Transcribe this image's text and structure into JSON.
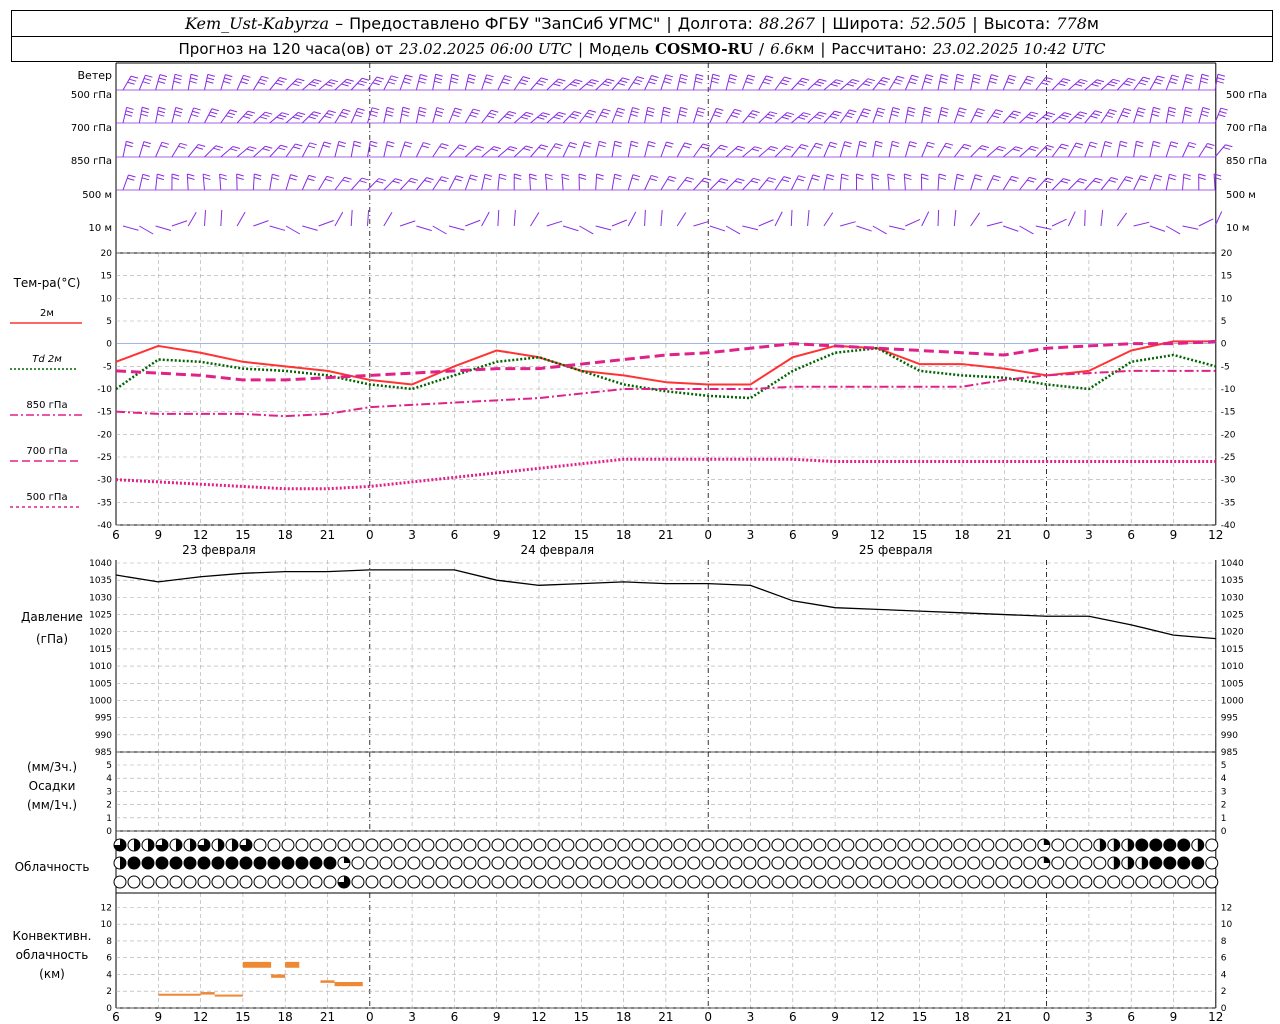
{
  "header": {
    "station": "Kem_Ust-Kabyrza",
    "dash": "–",
    "provider": "Предоставлено ФГБУ \"ЗапСиб УГМС\"",
    "sep": "|",
    "lon_label": "Долгота:",
    "lon": "88.267",
    "lat_label": "Широта:",
    "lat": "52.505",
    "alt_label": "Высота:",
    "alt": "778",
    "alt_unit": "м",
    "forecast": "Прогноз на 120 часа(ов) от",
    "start": "23.02.2025 06:00 UTC",
    "model_label": "Модель",
    "model": "COSMO-RU",
    "slash": "/",
    "res": "6.6",
    "res_unit": "км",
    "calc_label": "Рассчитано:",
    "calc": "23.02.2025 10:42 UTC"
  },
  "wind": {
    "title": "Ветер",
    "levels": [
      "500 гПа",
      "700 гПа",
      "850 гПа",
      "500 м",
      "10  м"
    ],
    "levels_right": [
      "500 гПа",
      "700 гПа",
      "850 гПа",
      "500 м",
      "10  м"
    ],
    "color": "#8a2be2"
  },
  "axis": {
    "hours": [
      "6",
      "9",
      "12",
      "15",
      "18",
      "21",
      "0",
      "3",
      "6",
      "9",
      "12",
      "15",
      "18",
      "21",
      "0",
      "3",
      "6",
      "9",
      "12",
      "15",
      "18",
      "21",
      "0",
      "3",
      "6",
      "9",
      "12"
    ],
    "dates": [
      "23 февраля",
      "24 февраля",
      "25 февраля"
    ]
  },
  "temp_panel": {
    "title": "Тем-ра(°С)",
    "legend": [
      {
        "label": "2м",
        "color": "#ff3333",
        "dash": "solid"
      },
      {
        "label": "Td  2м",
        "color": "#006400",
        "dash": "dotted"
      },
      {
        "label": "850 гПа",
        "color": "#e0218a",
        "dash": "dashdot"
      },
      {
        "label": "700 гПа",
        "color": "#e0218a",
        "dash": "dash"
      },
      {
        "label": "500 гПа",
        "color": "#e0218a",
        "dash": "dot"
      }
    ],
    "ticks": [
      "20",
      "15",
      "10",
      "5",
      "0",
      "-5",
      "-10",
      "-15",
      "-20",
      "-25",
      "-30",
      "-35",
      "-40"
    ]
  },
  "pressure_panel": {
    "title": "Давление",
    "unit": "(гПа)",
    "ticks": [
      "1040",
      "1035",
      "1030",
      "1025",
      "1020",
      "1015",
      "1010",
      "1005",
      "1000",
      "995",
      "990",
      "985"
    ]
  },
  "precip_panel": {
    "unit1": "(мм/3ч.)",
    "title": "Осадки",
    "unit2": "(мм/1ч.)",
    "ticks": [
      "5",
      "4",
      "3",
      "2",
      "1",
      "0"
    ]
  },
  "cloud_panel": {
    "title": "Облачность"
  },
  "conv_panel": {
    "title1": "Конвективн.",
    "title2": "облачность",
    "unit": "(км)",
    "ticks": [
      "12",
      "10",
      "8",
      "6",
      "4",
      "2",
      "0"
    ]
  },
  "chart_data": [
    {
      "type": "line",
      "name": "temperature",
      "x_hours_from_start": [
        0,
        3,
        6,
        9,
        12,
        15,
        18,
        21,
        24,
        27,
        30,
        33,
        36,
        39,
        42,
        45,
        48,
        51,
        54,
        57,
        60,
        63,
        66,
        69,
        72,
        75,
        78
      ],
      "ylim": [
        -40,
        20
      ],
      "series": [
        {
          "name": "2м",
          "color": "#ff3333",
          "values": [
            -4,
            -0.5,
            -2,
            -4,
            -5,
            -6,
            -8,
            -9,
            -5,
            -1.5,
            -3,
            -6,
            -7,
            -8.5,
            -9,
            -9,
            -3,
            -0.5,
            -1,
            -4.5,
            -4.5,
            -5.5,
            -7,
            -6,
            -1.5,
            0.5,
            0.5
          ]
        },
        {
          "name": "Td  2м",
          "color": "#006400",
          "values": [
            -10,
            -3.5,
            -4,
            -5.5,
            -6,
            -7,
            -9,
            -10,
            -7,
            -4,
            -3,
            -6,
            -9,
            -10.5,
            -11.5,
            -12,
            -6,
            -2,
            -1,
            -6,
            -7,
            -7.5,
            -9,
            -10,
            -4,
            -2.5,
            -5
          ]
        },
        {
          "name": "850 гПа",
          "color": "#e0218a",
          "values": [
            -15,
            -15.5,
            -15.5,
            -15.5,
            -16,
            -15.5,
            -14,
            -13.5,
            -13,
            -12.5,
            -12,
            -11,
            -10,
            -10,
            -10,
            -10,
            -9.5,
            -9.5,
            -9.5,
            -9.5,
            -9.5,
            -8,
            -7,
            -6.5,
            -6,
            -6,
            -6
          ]
        },
        {
          "name": "700 гПа",
          "color": "#e0218a",
          "values": [
            -6,
            -6.5,
            -7,
            -8,
            -8,
            -7.5,
            -7,
            -6.5,
            -6,
            -5.5,
            -5.5,
            -4.5,
            -3.5,
            -2.5,
            -2,
            -1,
            0,
            -0.5,
            -1,
            -1.5,
            -2,
            -2.5,
            -1,
            -0.5,
            0,
            0,
            0.5
          ]
        },
        {
          "name": "500 гПа",
          "color": "#e0218a",
          "values": [
            -30,
            -30.5,
            -31,
            -31.5,
            -32,
            -32,
            -31.5,
            -30.5,
            -29.5,
            -28.5,
            -27.5,
            -26.5,
            -25.5,
            -25.5,
            -25.5,
            -25.5,
            -25.5,
            -26,
            -26,
            -26,
            -26,
            -26,
            -26,
            -26,
            -26,
            -26,
            -26
          ]
        }
      ]
    },
    {
      "type": "line",
      "name": "pressure",
      "x_hours_from_start": [
        0,
        3,
        6,
        9,
        12,
        15,
        18,
        21,
        24,
        27,
        30,
        33,
        36,
        39,
        42,
        45,
        48,
        51,
        54,
        57,
        60,
        63,
        66,
        69,
        72,
        75,
        78
      ],
      "ylim": [
        985,
        1040
      ],
      "series": [
        {
          "name": "pressure",
          "color": "#000000",
          "values": [
            1036.5,
            1034.5,
            1036,
            1037,
            1037.5,
            1037.5,
            1038,
            1038,
            1038,
            1035,
            1033.5,
            1034,
            1034.5,
            1034,
            1034,
            1033.5,
            1029,
            1027,
            1026.5,
            1026,
            1025.5,
            1025,
            1024.5,
            1024.5,
            1022,
            1019,
            1018
          ]
        }
      ]
    },
    {
      "type": "bar",
      "name": "convective_cloud",
      "unit": "km",
      "ylim": [
        0,
        13
      ],
      "segments": [
        {
          "from_hour": 3,
          "to_hour": 6,
          "bottom": 1.5,
          "top": 1.7
        },
        {
          "from_hour": 6,
          "to_hour": 7,
          "bottom": 1.6,
          "top": 1.9
        },
        {
          "from_hour": 7,
          "to_hour": 9,
          "bottom": 1.4,
          "top": 1.6
        },
        {
          "from_hour": 9,
          "to_hour": 11,
          "bottom": 4.8,
          "top": 5.5
        },
        {
          "from_hour": 11,
          "to_hour": 12,
          "bottom": 3.6,
          "top": 4.0
        },
        {
          "from_hour": 12,
          "to_hour": 13,
          "bottom": 4.8,
          "top": 5.5
        },
        {
          "from_hour": 14.5,
          "to_hour": 15.5,
          "bottom": 3.0,
          "top": 3.3
        },
        {
          "from_hour": 15.5,
          "to_hour": 17.5,
          "bottom": 2.6,
          "top": 3.1
        }
      ]
    }
  ]
}
